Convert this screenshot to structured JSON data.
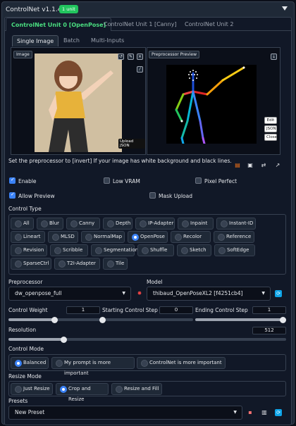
{
  "header": {
    "title": "ControlNet v1.1.445",
    "badge": "1 unit"
  },
  "unit_tabs": [
    {
      "label": "ControlNet Unit 0 [OpenPose]"
    },
    {
      "label": "ControlNet Unit 1 [Canny]"
    },
    {
      "label": "ControlNet Unit 2"
    }
  ],
  "sub_tabs": [
    {
      "label": "Single Image"
    },
    {
      "label": "Batch"
    },
    {
      "label": "Multi-Inputs"
    }
  ],
  "image_panel": {
    "label": "Image",
    "upload_json": "Upload JSON",
    "watermark": "…loading"
  },
  "preview_panel": {
    "label": "Preprocessor Preview",
    "side_buttons": [
      "Edit",
      "JSON",
      "Close"
    ]
  },
  "hint_text": "Set the preprocessor to [invert] If your image has white background and black lines.",
  "checkboxes": {
    "enable": {
      "label": "Enable",
      "checked": true
    },
    "low_vram": {
      "label": "Low VRAM",
      "checked": false
    },
    "pixel_perfect": {
      "label": "Pixel Perfect",
      "checked": false
    },
    "allow_preview": {
      "label": "Allow Preview",
      "checked": true
    },
    "mask_upload": {
      "label": "Mask Upload",
      "checked": false
    }
  },
  "control_type": {
    "label": "Control Type",
    "selected": "OpenPose",
    "options": [
      "All",
      "Blur",
      "Canny",
      "Depth",
      "IP-Adapter",
      "Inpaint",
      "Instant-ID",
      "Lineart",
      "MLSD",
      "NormalMap",
      "OpenPose",
      "Recolor",
      "Reference",
      "Revision",
      "Scribble",
      "Segmentation",
      "Shuffle",
      "Sketch",
      "SoftEdge",
      "SparseCtrl",
      "T2I-Adapter",
      "Tile"
    ]
  },
  "preprocessor": {
    "label": "Preprocessor",
    "value": "dw_openpose_full"
  },
  "model": {
    "label": "Model",
    "value": "thibaud_OpenPoseXL2 [f4251cb4]"
  },
  "control_weight": {
    "label": "Control Weight",
    "value": "1",
    "fraction": 0.5
  },
  "start_step": {
    "label": "Starting Control Step",
    "value": "0",
    "fraction": 0.0
  },
  "end_step": {
    "label": "Ending Control Step",
    "value": "1",
    "fraction": 1.0
  },
  "resolution": {
    "label": "Resolution",
    "value": "512",
    "fraction": 0.2
  },
  "control_mode": {
    "label": "Control Mode",
    "selected": "Balanced",
    "options": [
      "Balanced",
      "My prompt is more important",
      "ControlNet is more important"
    ]
  },
  "resize_mode": {
    "label": "Resize Mode",
    "selected": "Crop and Resize",
    "options": [
      "Just Resize",
      "Crop and Resize",
      "Resize and Fill"
    ]
  },
  "presets": {
    "label": "Presets",
    "value": "New Preset"
  },
  "colors": {
    "accent": "#3b82f6",
    "active_tab": "#4ade80",
    "badge": "#22c55e"
  }
}
